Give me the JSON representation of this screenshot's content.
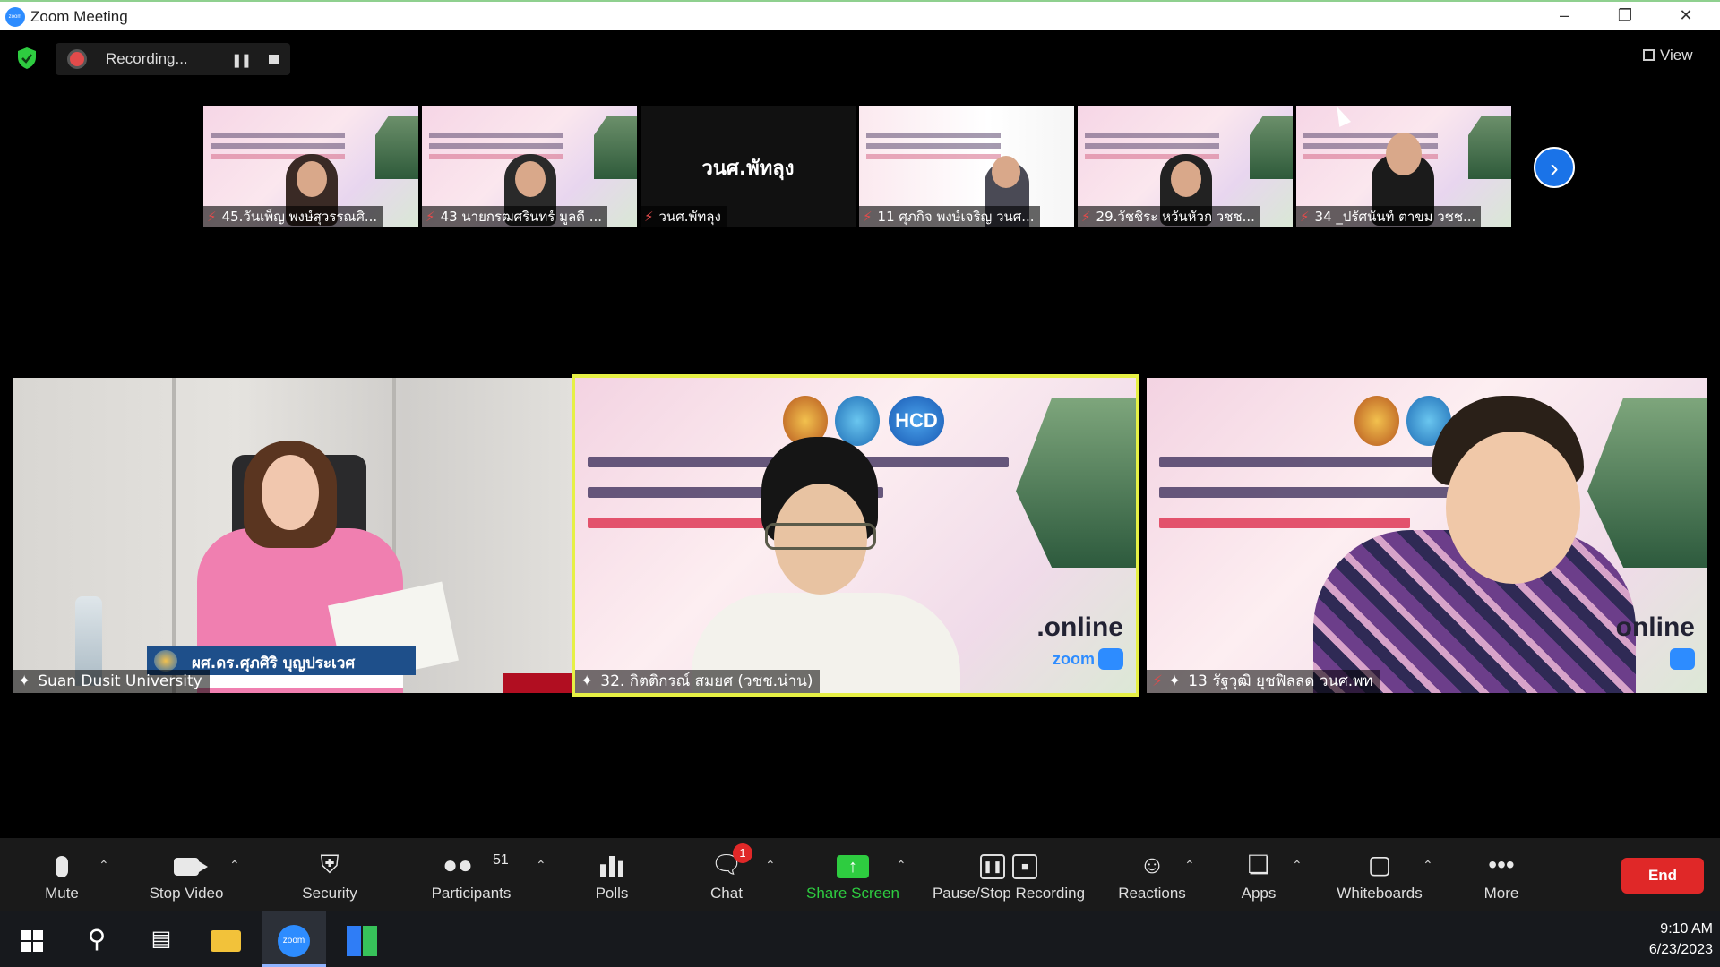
{
  "window": {
    "app_icon": "zoom",
    "title": "Zoom Meeting",
    "controls": [
      "minimize",
      "maximize",
      "close"
    ]
  },
  "topbar": {
    "recording_label": "Recording...",
    "view_label": "View"
  },
  "thumbnails": [
    {
      "name": "45.วันเพ็ญ พงษ์สุวรรณศิ...",
      "muted": true
    },
    {
      "name": "43 นายกรฒศรินทร์ มูลดี ...",
      "muted": true
    },
    {
      "name": "วนศ.พัทลุง",
      "muted": true,
      "video_off": true,
      "display_name": "วนศ.พัทลุง"
    },
    {
      "name": "11 ศุภกิจ พงษ์เจริญ วนศ...",
      "muted": true
    },
    {
      "name": "29.วัชชิระ หวันหัวก วชช...",
      "muted": true
    },
    {
      "name": "34 _ปรัศนันท์ ตาขม วชช...",
      "muted": true
    }
  ],
  "main_tiles": [
    {
      "name": "Suan Dusit University",
      "pinned": true,
      "lower_third": "ผศ.ดร.ศุภศิริ บุญประเวศ"
    },
    {
      "name": "32. กิตติกรณ์ สมยศ (วชช.น่าน)",
      "pinned": true,
      "active_speaker": true,
      "overlay": ".online"
    },
    {
      "name": "13 รัฐวุฒิ ยุชฟิลลด วนศ.พท",
      "pinned": true,
      "muted": true,
      "overlay": "online"
    }
  ],
  "toolbar": {
    "mute": "Mute",
    "stop_video": "Stop Video",
    "security": "Security",
    "participants": "Participants",
    "participant_count": "51",
    "polls": "Polls",
    "chat": "Chat",
    "chat_badge": "1",
    "share_screen": "Share Screen",
    "pause_stop_recording": "Pause/Stop Recording",
    "reactions": "Reactions",
    "apps": "Apps",
    "whiteboards": "Whiteboards",
    "more": "More",
    "end": "End"
  },
  "taskbar": {
    "time": "9:10 AM",
    "date": "6/23/2023"
  },
  "colors": {
    "active_speaker_border": "#e6f045",
    "end_button": "#e02828",
    "share_screen": "#2ecc40",
    "recording_dot": "#e24b4b"
  }
}
